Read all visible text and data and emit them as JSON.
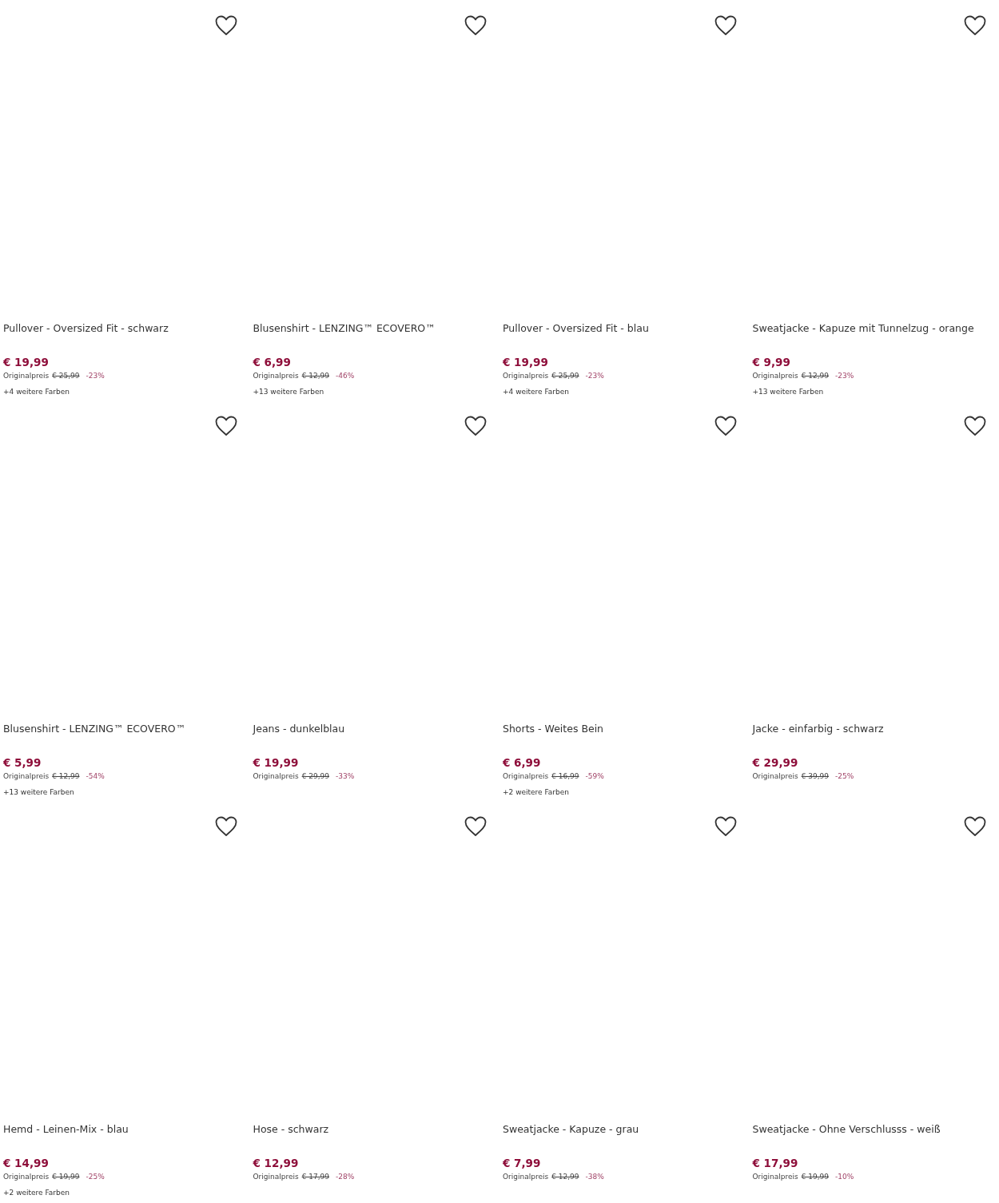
{
  "products": [
    {
      "title": "Pullover - Oversized Fit - schwarz",
      "price": "€ 19,99",
      "original_label": "Originalpreis",
      "original_price": "€ 25,99",
      "discount": "-23%",
      "more_colors": "+4 weitere Farben"
    },
    {
      "title": "Blusenshirt - LENZING™ ECOVERO™",
      "price": "€ 6,99",
      "original_label": "Originalpreis",
      "original_price": "€ 12,99",
      "discount": "-46%",
      "more_colors": "+13 weitere Farben"
    },
    {
      "title": "Pullover - Oversized Fit - blau",
      "price": "€ 19,99",
      "original_label": "Originalpreis",
      "original_price": "€ 25,99",
      "discount": "-23%",
      "more_colors": "+4 weitere Farben"
    },
    {
      "title": "Sweatjacke - Kapuze mit Tunnelzug - orange",
      "price": "€ 9,99",
      "original_label": "Originalpreis",
      "original_price": "€ 12,99",
      "discount": "-23%",
      "more_colors": "+13 weitere Farben"
    },
    {
      "title": "Blusenshirt - LENZING™ ECOVERO™",
      "price": "€ 5,99",
      "original_label": "Originalpreis",
      "original_price": "€ 12,99",
      "discount": "-54%",
      "more_colors": "+13 weitere Farben"
    },
    {
      "title": "Jeans - dunkelblau",
      "price": "€ 19,99",
      "original_label": "Originalpreis",
      "original_price": "€ 29,99",
      "discount": "-33%"
    },
    {
      "title": "Shorts - Weites Bein",
      "price": "€ 6,99",
      "original_label": "Originalpreis",
      "original_price": "€ 16,99",
      "discount": "-59%",
      "more_colors": "+2 weitere Farben"
    },
    {
      "title": "Jacke - einfarbig - schwarz",
      "price": "€ 29,99",
      "original_label": "Originalpreis",
      "original_price": "€ 39,99",
      "discount": "-25%"
    },
    {
      "title": "Hemd - Leinen-Mix - blau",
      "price": "€ 14,99",
      "original_label": "Originalpreis",
      "original_price": "€ 19,99",
      "discount": "-25%",
      "more_colors": "+2 weitere Farben"
    },
    {
      "title": "Hose - schwarz",
      "price": "€ 12,99",
      "original_label": "Originalpreis",
      "original_price": "€ 17,99",
      "discount": "-28%"
    },
    {
      "title": "Sweatjacke - Kapuze - grau",
      "price": "€ 7,99",
      "original_label": "Originalpreis",
      "original_price": "€ 12,99",
      "discount": "-38%"
    },
    {
      "title": "Sweatjacke - Ohne Verschlusss - weiß",
      "price": "€ 17,99",
      "original_label": "Originalpreis",
      "original_price": "€ 19,99",
      "discount": "-10%"
    }
  ]
}
